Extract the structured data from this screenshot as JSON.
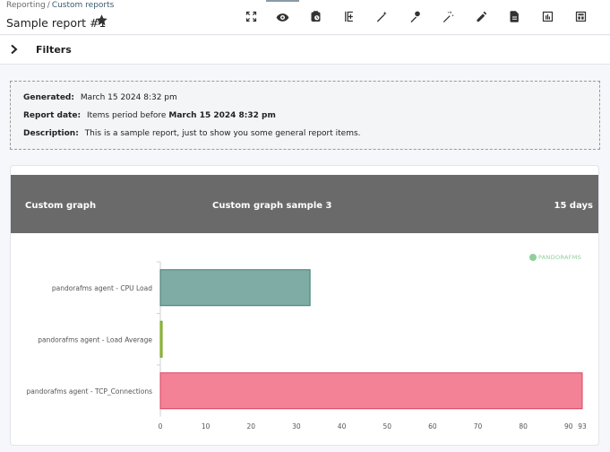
{
  "breadcrumb": {
    "root": "Reporting",
    "separator": "/",
    "current": "Custom reports"
  },
  "page": {
    "title": "Sample report #1"
  },
  "toolbar": {
    "tabs": [
      {
        "icon": "fullscreen-icon",
        "active": false
      },
      {
        "icon": "eye-icon",
        "active": true
      },
      {
        "icon": "scheduled-icon",
        "active": false
      },
      {
        "icon": "add-item-icon",
        "active": false
      },
      {
        "icon": "magic-wand-icon",
        "active": false
      },
      {
        "icon": "pin-icon",
        "active": false
      },
      {
        "icon": "wizard-icon",
        "active": false
      },
      {
        "icon": "pencil-icon",
        "active": false
      },
      {
        "icon": "document-icon",
        "active": false
      },
      {
        "icon": "bar-chart-icon",
        "active": false
      },
      {
        "icon": "report-grid-icon",
        "active": false
      }
    ]
  },
  "filters": {
    "label": "Filters"
  },
  "info": {
    "generated_label": "Generated:",
    "generated_value": "March 15 2024 8:32 pm",
    "report_date_label": "Report date:",
    "report_date_prefix": "Items period before",
    "report_date_value": "March 15 2024 8:32 pm",
    "description_label": "Description:",
    "description_value": "This is a sample report, just to show you some general report items."
  },
  "item": {
    "type": "Custom graph",
    "name": "Custom graph sample 3",
    "period": "15 days",
    "watermark": "PANDORAFMS"
  },
  "colors": {
    "header_bg": "#6a6a6a",
    "bar_cpu": "#80aca6",
    "bar_load": "#a0cf40",
    "bar_tcp": "#f48296"
  },
  "chart_data": {
    "type": "bar",
    "orientation": "horizontal",
    "categories": [
      "pandorafms agent - CPU Load",
      "pandorafms agent - Load Average",
      "pandorafms agent - TCP_Connections"
    ],
    "values": [
      33,
      0.4,
      93
    ],
    "xlim": [
      0,
      93
    ],
    "xticks": [
      "0",
      "10",
      "20",
      "30",
      "40",
      "50",
      "60",
      "70",
      "80",
      "90",
      "93"
    ],
    "grid": false,
    "title": "",
    "xlabel": "",
    "ylabel": ""
  }
}
